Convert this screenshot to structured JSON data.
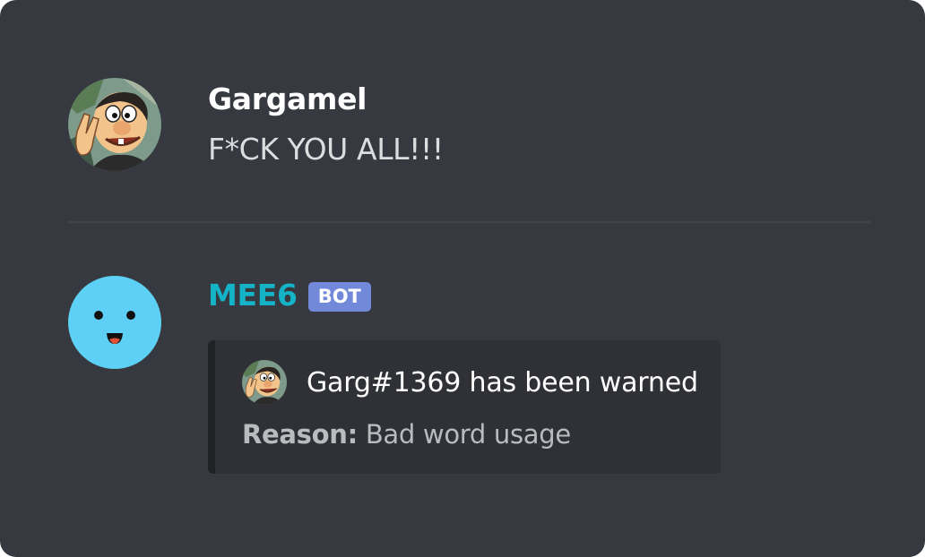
{
  "colors": {
    "background": "#36393f",
    "embed_background": "#2f3136",
    "bot_name": "#14b3c7",
    "bot_tag": "#7289da"
  },
  "messages": [
    {
      "author": "Gargamel",
      "avatar_icon": "gargamel-avatar-icon",
      "content": "F*CK YOU ALL!!!"
    },
    {
      "author": "MEE6",
      "avatar_icon": "mee6-face-icon",
      "bot_tag": "BOT",
      "embed": {
        "author_icon": "gargamel-avatar-icon",
        "title": "Garg#1369 has been warned",
        "field_label": "Reason:",
        "field_value": "Bad word usage"
      }
    }
  ]
}
